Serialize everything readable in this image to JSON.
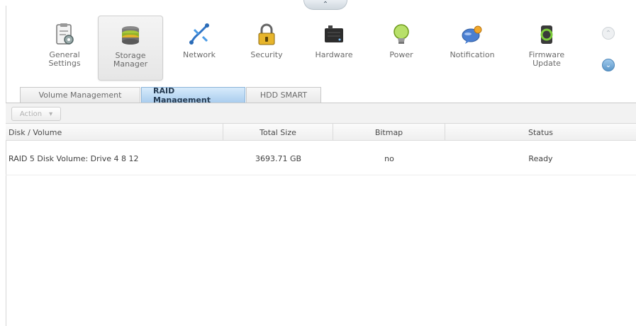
{
  "collapse_glyph": "⌃",
  "toolbar": {
    "items": [
      {
        "label": "General\nSettings",
        "icon": "general-settings-icon"
      },
      {
        "label": "Storage\nManager",
        "icon": "storage-manager-icon",
        "active": true
      },
      {
        "label": "Network",
        "icon": "network-icon"
      },
      {
        "label": "Security",
        "icon": "security-lock-icon"
      },
      {
        "label": "Hardware",
        "icon": "hardware-icon"
      },
      {
        "label": "Power",
        "icon": "power-bulb-icon"
      },
      {
        "label": "Notification",
        "icon": "notification-icon"
      },
      {
        "label": "Firmware\nUpdate",
        "icon": "firmware-update-icon"
      }
    ],
    "scroll_up_glyph": "⌃",
    "scroll_down_glyph": "⌄"
  },
  "tabs": [
    {
      "label": "Volume Management"
    },
    {
      "label": "RAID Management",
      "selected": true
    },
    {
      "label": "HDD SMART"
    }
  ],
  "action": {
    "label": "Action",
    "caret": "▾"
  },
  "table": {
    "columns": [
      "Disk / Volume",
      "Total Size",
      "Bitmap",
      "Status"
    ],
    "rows": [
      {
        "disk": "RAID 5 Disk Volume: Drive 4 8 12",
        "size": "3693.71 GB",
        "bitmap": "no",
        "status": "Ready"
      }
    ]
  },
  "colors": {
    "accent_tab": "#aacdee",
    "scroll_down": "#5c97c9"
  }
}
